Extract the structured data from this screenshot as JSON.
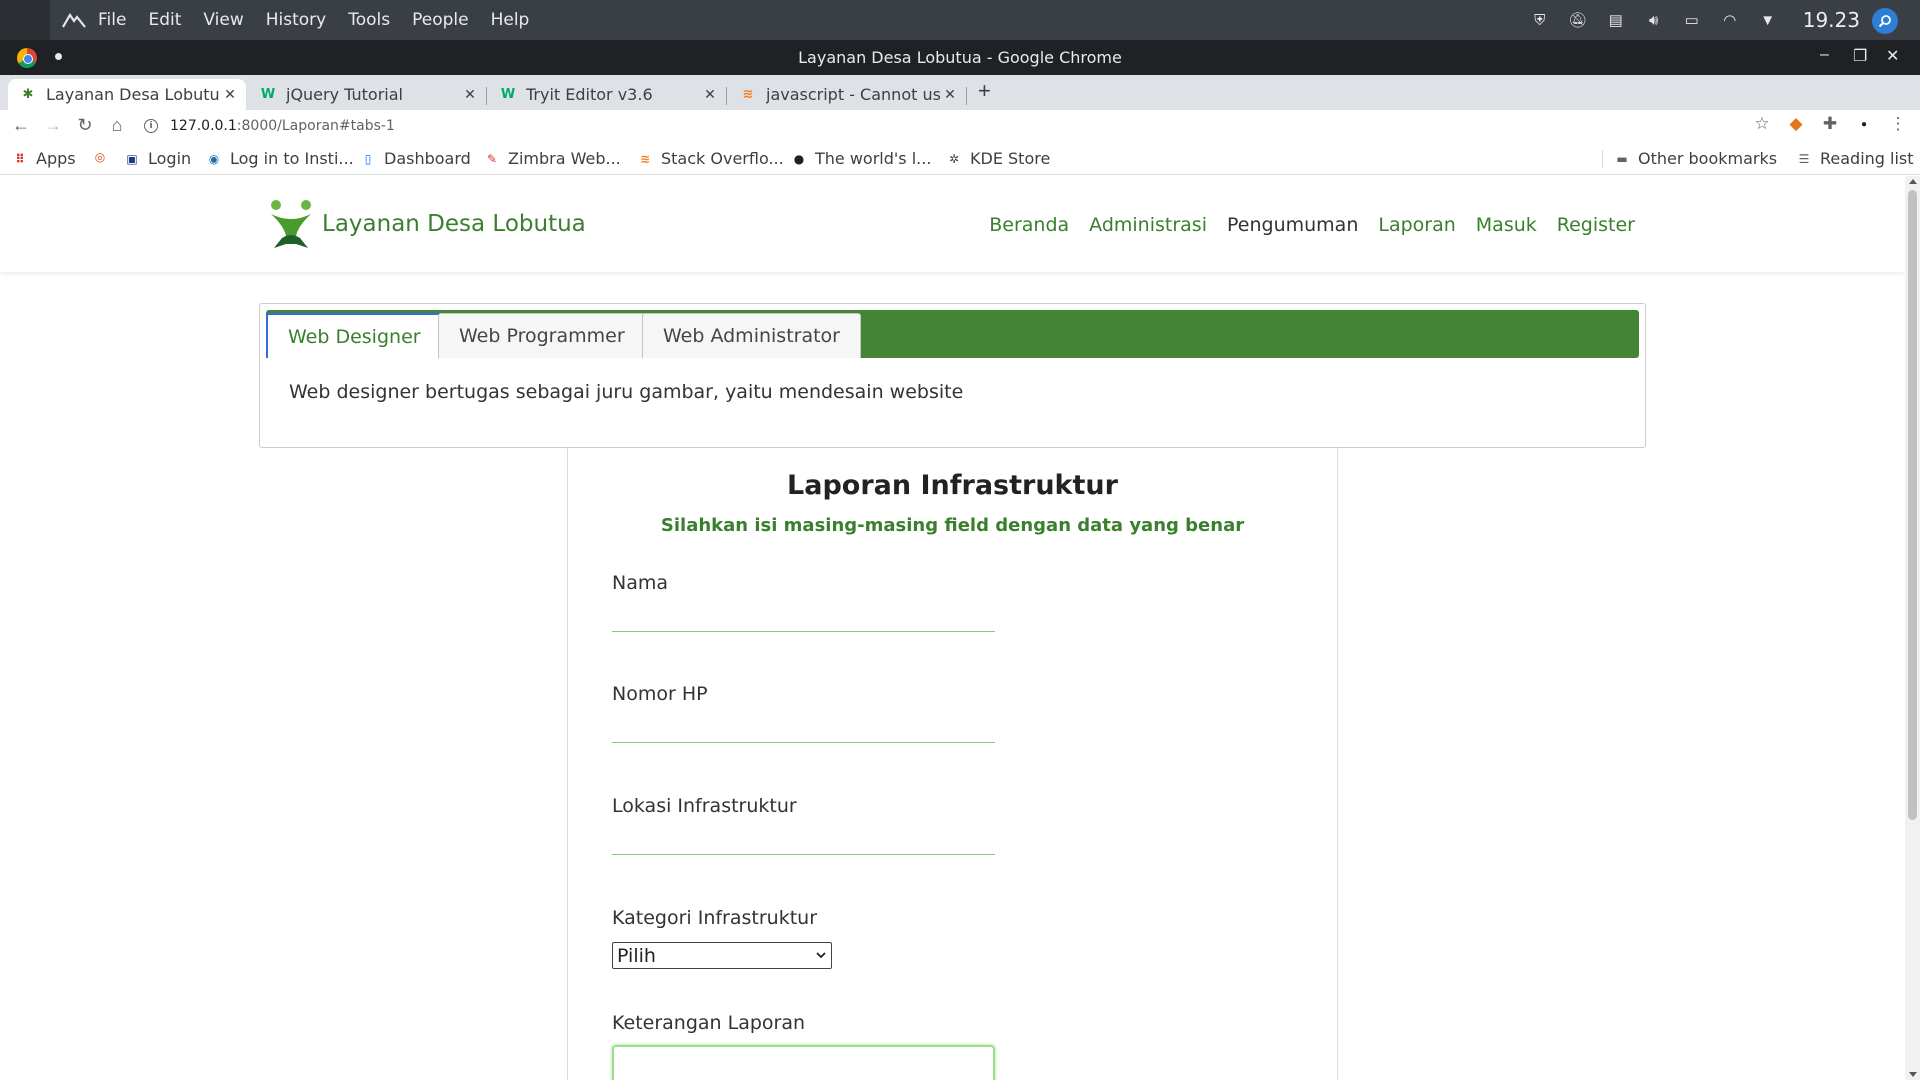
{
  "os_panel": {
    "menu": [
      "File",
      "Edit",
      "View",
      "History",
      "Tools",
      "People",
      "Help"
    ],
    "clock": "19.23"
  },
  "window": {
    "title": "Layanan Desa Lobutua - Google Chrome"
  },
  "tabs": [
    {
      "label": "Layanan Desa Lobutua",
      "icon": "site-logo-icon"
    },
    {
      "label": "jQuery Tutorial",
      "icon": "w3schools-icon"
    },
    {
      "label": "Tryit Editor v3.6",
      "icon": "w3schools-icon"
    },
    {
      "label": "javascript - Cannot use",
      "icon": "stackoverflow-icon"
    }
  ],
  "address_bar": {
    "host": "127.0.0.1",
    "path": ":8000/Laporan#tabs-1"
  },
  "bookmarks": {
    "items": [
      "Apps",
      "Login",
      "Log in to Insti...",
      "Dashboard",
      "Zimbra Web...",
      "Stack Overflo...",
      "The world's l...",
      "KDE Store"
    ],
    "other": "Other bookmarks",
    "reading_list": "Reading list"
  },
  "site": {
    "brand": "Layanan Desa Lobutua",
    "nav": [
      "Beranda",
      "Administrasi",
      "Pengumuman",
      "Laporan",
      "Masuk",
      "Register"
    ],
    "nav_active_index": 2,
    "accent_color": "#3a7f2e"
  },
  "tabs_widget": {
    "tabs": [
      "Web Designer",
      "Web Programmer",
      "Web Administrator"
    ],
    "active_index": 0,
    "content": "Web designer bertugas sebagai juru gambar, yaitu mendesain website",
    "header_color": "#438534"
  },
  "form": {
    "title": "Laporan Infrastruktur",
    "subtitle": "Silahkan isi masing-masing field dengan data yang benar",
    "fields": {
      "nama": "Nama",
      "nomor_hp": "Nomor HP",
      "lokasi": "Lokasi Infrastruktur",
      "kategori": "Kategori Infrastruktur",
      "keterangan": "Keterangan Laporan"
    },
    "kategori_selected": "Pilih"
  }
}
